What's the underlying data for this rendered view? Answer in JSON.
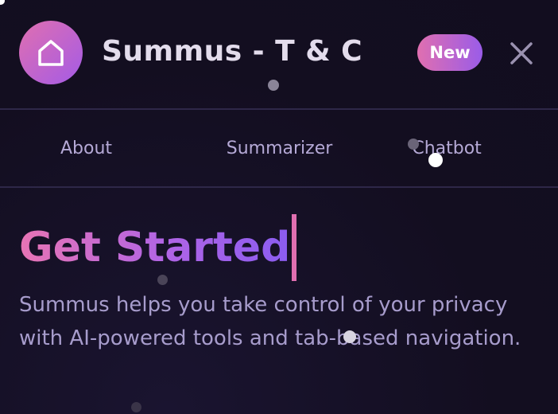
{
  "header": {
    "title": "Summus - T & C",
    "badge": "New",
    "logo_icon": "home-icon",
    "close_icon": "close-icon"
  },
  "tabs": [
    {
      "label": "About"
    },
    {
      "label": "Summarizer"
    },
    {
      "label": "Chatbot"
    }
  ],
  "main": {
    "heading": "Get Started",
    "description": "Summus helps you take control of your privacy with AI-powered tools and tab-based navigation."
  },
  "colors": {
    "background": "#140f22",
    "accent_pink": "#e06fb0",
    "accent_purple": "#9a5ce8",
    "text_muted": "#a79ccc",
    "divider": "#2e2748"
  }
}
